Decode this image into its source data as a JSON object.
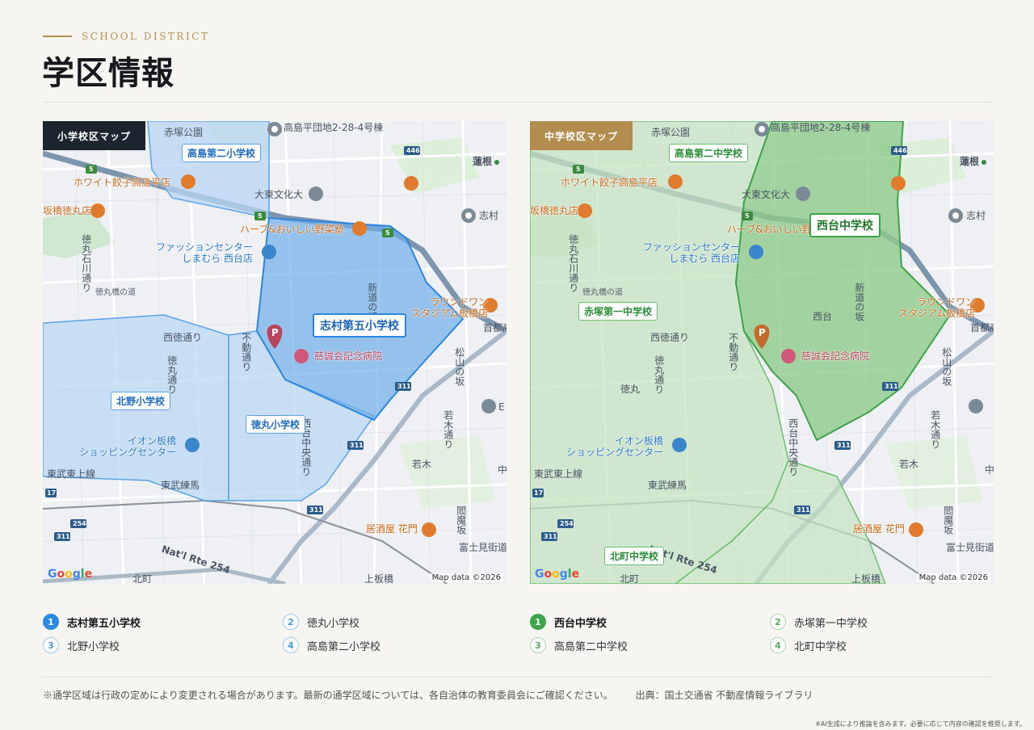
{
  "header": {
    "eyebrow": "SCHOOL DISTRICT",
    "title": "学区情報"
  },
  "colors": {
    "gold": "#b58f4e",
    "elementary_blue": "#2b8ae4",
    "middle_green": "#3da54b"
  },
  "maps": {
    "elementary": {
      "tag": "小学校区マップ",
      "primary_school": "志村第五小学校",
      "schools": [
        "高島第二小学校",
        "北野小学校",
        "徳丸小学校"
      ]
    },
    "middle": {
      "tag": "中学校区マップ",
      "primary_school": "西台中学校",
      "schools": [
        "高島第二中学校",
        "赤塚第一中学校",
        "北町中学校"
      ]
    },
    "place_labels": {
      "takashima_apt": "高島平団地2-28-4号棟",
      "akatsuka_park": "赤塚公園",
      "hasune": "蓮根",
      "white_gyoza": "ホワイト餃子高島平店",
      "daito_univ": "大東文化大",
      "harbe": "ハーブ&おいしい野菜塾",
      "shimura": "志村",
      "fashion_center": "ファッションセンター\nしまむら 西台店",
      "tokumaru_ito": "坂橋徳丸店",
      "round1": "ラウンドワン\nスタジアム板橋店",
      "jiseikai": "慈誠会記念病院",
      "aeon": "イオン板橋\nショッピングセンター",
      "izakaya": "居酒屋 花門",
      "fujimi": "富士見街道",
      "wakagi": "若木",
      "tobu_tojo": "東武東上線",
      "tobu_nerima": "東武練馬",
      "kitamachi": "北町",
      "kamiitabashi": "上板橋",
      "nishidai": "西台",
      "tokumaru": "徳丸",
      "nat_rte": "Nat'l Rte 254",
      "saitokudori": "西徳通り",
      "fudodori": "不動通り",
      "shimura_slope": "新道の坂",
      "shuto": "首都高速",
      "matsuyama": "松山の坂",
      "enmazaka": "閻魔坂",
      "nishidai_chuo": "西台中央通り",
      "tokumaru_dori": "徳丸通り",
      "tokumaru_ishikawa": "徳丸石川通り",
      "wakagi_dori": "若木通り",
      "tokumaru_no_michi": "徳丸橋の道",
      "e": "E",
      "naka": "中"
    },
    "route_numbers": [
      "5",
      "446",
      "311",
      "17",
      "254"
    ],
    "attribution": "Map data ©2026",
    "google": "Google",
    "parking": "P"
  },
  "legends": {
    "elementary": [
      {
        "num": "1",
        "name": "志村第五小学校"
      },
      {
        "num": "2",
        "name": "徳丸小学校"
      },
      {
        "num": "3",
        "name": "北野小学校"
      },
      {
        "num": "4",
        "name": "高島第二小学校"
      }
    ],
    "middle": [
      {
        "num": "1",
        "name": "西台中学校"
      },
      {
        "num": "2",
        "name": "赤塚第一中学校"
      },
      {
        "num": "3",
        "name": "高島第二中学校"
      },
      {
        "num": "4",
        "name": "北町中学校"
      }
    ]
  },
  "footer": {
    "note": "※通学区域は行政の定めにより変更される場合があります。最新の通学区域については、各自治体の教育委員会にご確認ください。",
    "source": "出典：国土交通省 不動産情報ライブラリ",
    "disclaimer": "※AI生成により推論を含みます。必要に応じて内容の確認を推奨します。"
  }
}
